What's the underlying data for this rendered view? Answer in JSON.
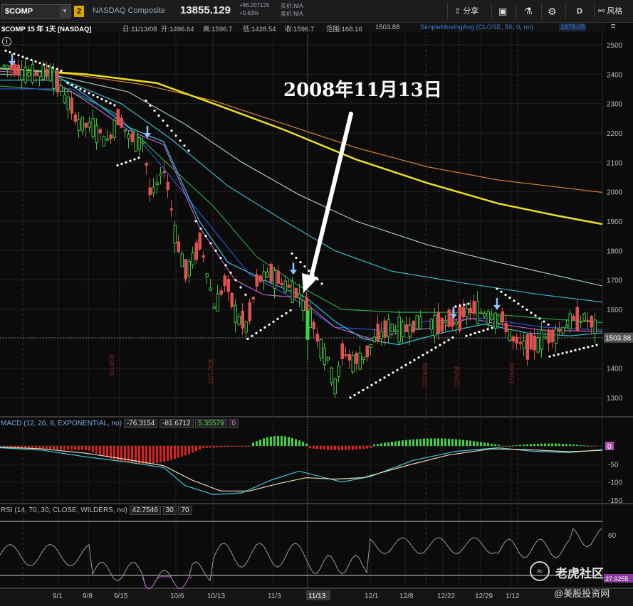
{
  "toolbar": {
    "symbol": "$COMP",
    "link_number": "2",
    "company": "NASDAQ Composite",
    "last": "13855.129",
    "change": "+86.207125",
    "change_pct": "+0.63%",
    "bid": "买价:N/A",
    "ask": "卖价:N/A",
    "share_label": "分享",
    "period_label": "D",
    "risk_label": "风格"
  },
  "infobar": {
    "title": "$COMP 15 年 1天 [NASDAQ]",
    "date": "日:11/13/08",
    "open": "开:1496.64",
    "high": "高:1596.7",
    "low": "低:1428.54",
    "close": "收:1596.7",
    "range": "范围:168.16",
    "value": "1503.88",
    "study": "SimpleMovingAvg (CLOSE, 50, 0, no)",
    "study_value": "1878.05"
  },
  "annotation": "2008年11月13日",
  "price_axis": {
    "ticks": [
      "2500",
      "2400",
      "2300",
      "2200",
      "2100",
      "2000",
      "1900",
      "1800",
      "1700",
      "1600",
      "1500",
      "1400",
      "1300"
    ],
    "current_label": "1503.88"
  },
  "date_axis": {
    "ticks": [
      "9/1",
      "9/8",
      "9/15",
      "10/6",
      "10/13",
      "11/3",
      "11/13",
      "12/1",
      "12/8",
      "12/22",
      "12/29",
      "1/12"
    ],
    "vertical_labels": [
      "9/19/08",
      "10/17/08",
      "12/19/08",
      "12/5/08",
      "1/16/09"
    ]
  },
  "macd": {
    "title": "MACD (12, 26, 9, EXPONENTIAL, no)",
    "v1": "-76.3154",
    "v2": "-81.6712",
    "v3": "5.35579",
    "v4": "0",
    "axis": [
      "-50",
      "-100",
      "-150"
    ],
    "zero_label": "0"
  },
  "rsi": {
    "title": "RSI (14, 70, 30, CLOSE, WILDERS, no)",
    "value": "42.7546",
    "ob": "30",
    "os": "70",
    "axis": [
      "60"
    ],
    "label30": "27.9255"
  },
  "watermark": {
    "line1": "老虎社区",
    "line2": "@美股投资网",
    "badge": "≈"
  },
  "colors": {
    "up": "#3cbf3c",
    "down": "#e05050",
    "sma200": "#e8e020",
    "sma250": "#d07a2a",
    "dots": "#ffffff",
    "arrow": "#8ec3ff"
  }
}
